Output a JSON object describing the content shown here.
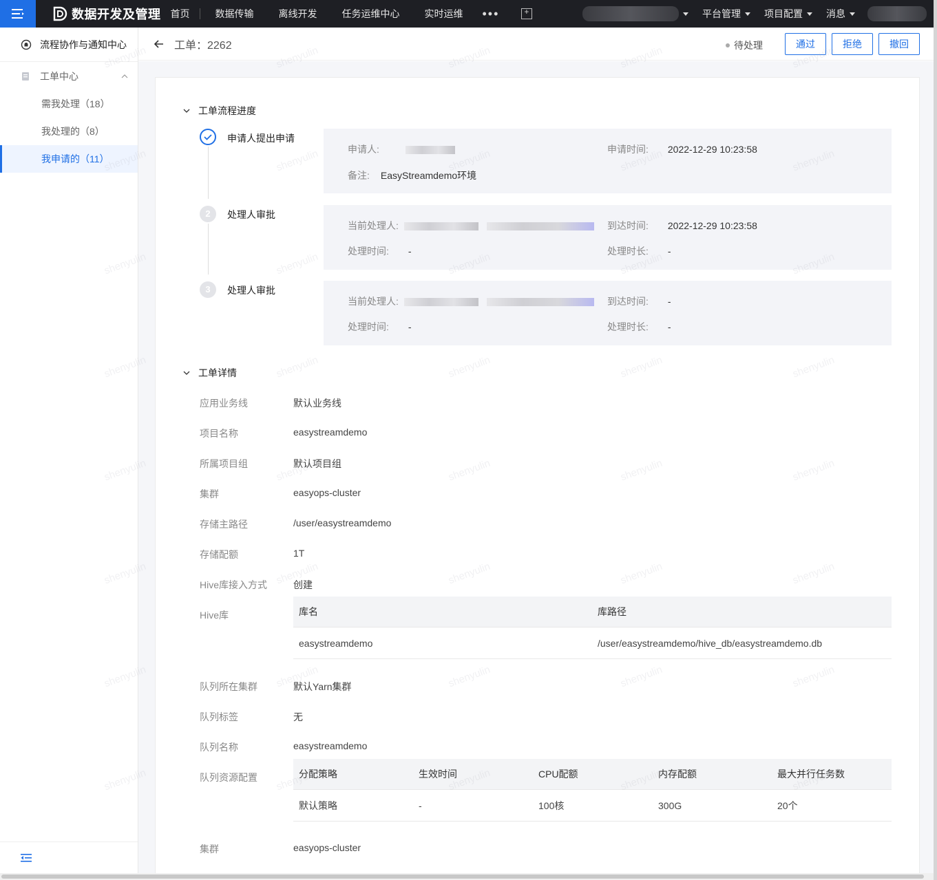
{
  "app": {
    "title": "数据开发及管理",
    "nav": [
      "首页",
      "数据传输",
      "离线开发",
      "任务运维中心",
      "实时运维"
    ],
    "more": "•••",
    "right_menus": [
      "平台管理",
      "项目配置",
      "消息"
    ]
  },
  "sidebar": {
    "header": "流程协作与通知中心",
    "group": "工单中心",
    "items": [
      {
        "label": "需我处理（18）"
      },
      {
        "label": "我处理的（8）"
      },
      {
        "label": "我申请的（11）"
      }
    ]
  },
  "page": {
    "title": "工单：2262",
    "status": "待处理",
    "actions": {
      "approve": "通过",
      "reject": "拒绝",
      "revoke": "撤回"
    }
  },
  "progress": {
    "title": "工单流程进度",
    "steps": [
      {
        "index": "1",
        "name": "申请人提出申请",
        "applicant_label": "申请人:",
        "time_label": "申请时间:",
        "time_value": "2022-12-29 10:23:58",
        "note_label": "备注:",
        "note_value": "EasyStreamdemo环境"
      },
      {
        "index": "2",
        "name": "处理人审批",
        "handler_label": "当前处理人:",
        "arrive_label": "到达时间:",
        "arrive_value": "2022-12-29 10:23:58",
        "proc_label": "处理时间:",
        "proc_value": "-",
        "dur_label": "处理时长:",
        "dur_value": "-"
      },
      {
        "index": "3",
        "name": "处理人审批",
        "handler_label": "当前处理人:",
        "arrive_label": "到达时间:",
        "arrive_value": "-",
        "proc_label": "处理时间:",
        "proc_value": "-",
        "dur_label": "处理时长:",
        "dur_value": "-"
      }
    ]
  },
  "details": {
    "title": "工单详情",
    "fields": [
      {
        "label": "应用业务线",
        "value": "默认业务线"
      },
      {
        "label": "项目名称",
        "value": "easystreamdemo"
      },
      {
        "label": "所属项目组",
        "value": "默认项目组"
      },
      {
        "label": "集群",
        "value": "easyops-cluster"
      },
      {
        "label": "存储主路径",
        "value": "/user/easystreamdemo"
      },
      {
        "label": "存储配额",
        "value": "1T"
      },
      {
        "label": "Hive库接入方式",
        "value": "创建"
      }
    ],
    "hive_label": "Hive库",
    "hive_table": {
      "headers": [
        "库名",
        "库路径"
      ],
      "rows": [
        [
          "easystreamdemo",
          "/user/easystreamdemo/hive_db/easystreamdemo.db"
        ]
      ]
    },
    "fields2": [
      {
        "label": "队列所在集群",
        "value": "默认Yarn集群"
      },
      {
        "label": "队列标签",
        "value": "无"
      },
      {
        "label": "队列名称",
        "value": "easystreamdemo"
      }
    ],
    "queue_label": "队列资源配置",
    "queue_table": {
      "headers": [
        "分配策略",
        "生效时间",
        "CPU配额",
        "内存配额",
        "最大并行任务数"
      ],
      "rows": [
        [
          "默认策略",
          "-",
          "100核",
          "300G",
          "20个"
        ]
      ]
    },
    "last_field": {
      "label": "集群",
      "value": "easyops-cluster"
    }
  },
  "watermark": "shenyulin",
  "colors": {
    "primary": "#1f6fe5",
    "topbar": "#1e1f24"
  }
}
